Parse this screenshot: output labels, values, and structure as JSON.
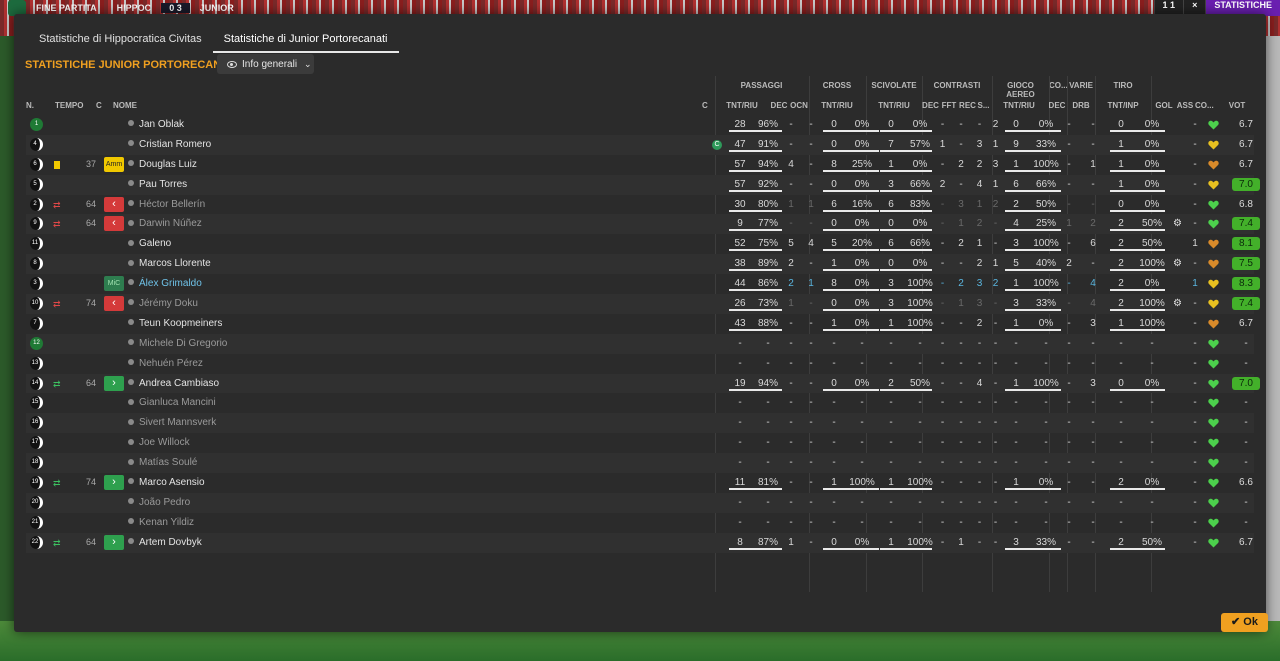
{
  "topbar": {
    "status": "FINE PARTITA",
    "home": "HIPPOC",
    "score": "0 3",
    "away": "JUNIOR",
    "right1": "1 1",
    "right2": "×",
    "right3": "STATISTICHE"
  },
  "tabs": [
    "Statistiche di Hippocratica Civitas",
    "Statistiche di Junior Portorecanati"
  ],
  "heading": "STATISTICHE JUNIOR PORTORECANATI",
  "dropdown": {
    "label": "Info generali"
  },
  "group_headers": {
    "passaggi": "PASSAGGI",
    "cross": "CROSS",
    "scivolate": "SCIVOLATE",
    "contrasti": "CONTRASTI",
    "gioco_aereo": "GIOCO AEREO",
    "co": "CO...",
    "varie": "VARIE",
    "tiro": "TIRO"
  },
  "column_headers": {
    "n": "N.",
    "tempo": "TEMPO",
    "c": "C",
    "nome": "NOME",
    "c2": "C",
    "p_tnt": "TNT/RIU",
    "p_dec": "DEC",
    "p_ocn": "OCN",
    "cr_tnt": "TNT/RIU",
    "sc_tnt": "TNT/RIU",
    "ct_dec": "DEC",
    "ct_fft": "FFT",
    "ct_rec": "REC",
    "ct_s": "S...",
    "ga_tnt": "TNT/RIU",
    "co_dec": "DEC",
    "va_drb": "DRB",
    "ti_tnt": "TNT/INP",
    "gol": "GOL",
    "ass": "ASS",
    "co2": "CO...",
    "vot": "VOT"
  },
  "ok_label": "Ok",
  "colors": {
    "accent": "#f0a020",
    "vote_green": "#43b02a",
    "heart_green": "#4cd04c",
    "heart_yellow": "#e8c020",
    "heart_orange": "#d88a2a"
  },
  "players": [
    {
      "n": "1",
      "gk": true,
      "name": "Jan Oblak",
      "p": [
        "28",
        "96%"
      ],
      "pd": "-",
      "po": "-",
      "cr": [
        "0",
        "0%"
      ],
      "sc": [
        "0",
        "0%"
      ],
      "ct": [
        "-",
        "-",
        "-",
        "2"
      ],
      "ga": [
        "0",
        "0%"
      ],
      "cod": "-",
      "drb": "-",
      "ti": [
        "0",
        "0%"
      ],
      "gol": "",
      "ass": "-",
      "heart": "green",
      "vot": "6.7"
    },
    {
      "n": "4",
      "name": "Cristian Romero",
      "cap": true,
      "p": [
        "47",
        "91%"
      ],
      "pd": "-",
      "po": "-",
      "cr": [
        "0",
        "0%"
      ],
      "sc": [
        "7",
        "57%"
      ],
      "ct": [
        "1",
        "-",
        "3",
        "1"
      ],
      "ga": [
        "9",
        "33%"
      ],
      "cod": "-",
      "drb": "-",
      "ti": [
        "1",
        "0%"
      ],
      "gol": "",
      "ass": "-",
      "heart": "yellow",
      "vot": "6.7"
    },
    {
      "n": "6",
      "name": "Douglas Luiz",
      "card": true,
      "tempo": "37",
      "badge": "Amm",
      "btype": "amm",
      "p": [
        "57",
        "94%"
      ],
      "pd": "4",
      "po": "-",
      "cr": [
        "8",
        "25%"
      ],
      "sc": [
        "1",
        "0%"
      ],
      "ct": [
        "-",
        "2",
        "2",
        "3"
      ],
      "ga": [
        "1",
        "100%"
      ],
      "cod": "-",
      "drb": "1",
      "ti": [
        "1",
        "0%"
      ],
      "gol": "",
      "ass": "-",
      "heart": "orange",
      "vot": "6.7"
    },
    {
      "n": "5",
      "name": "Pau Torres",
      "p": [
        "57",
        "92%"
      ],
      "pd": "-",
      "po": "-",
      "cr": [
        "0",
        "0%"
      ],
      "sc": [
        "3",
        "66%"
      ],
      "ct": [
        "2",
        "-",
        "4",
        "1"
      ],
      "ga": [
        "6",
        "66%"
      ],
      "cod": "-",
      "drb": "-",
      "ti": [
        "1",
        "0%"
      ],
      "gol": "",
      "ass": "-",
      "heart": "yellow",
      "vot": "7.0",
      "vg": true
    },
    {
      "n": "2",
      "name": "Héctor Bellerín",
      "dim": true,
      "sub": "out",
      "tempo": "64",
      "badge": "‹",
      "btype": "out",
      "p": [
        "30",
        "80%"
      ],
      "pd": "1",
      "po": "1",
      "cr": [
        "6",
        "16%"
      ],
      "sc": [
        "6",
        "83%"
      ],
      "ct": [
        "-",
        "3",
        "1",
        "2"
      ],
      "ga": [
        "2",
        "50%"
      ],
      "cod": "-",
      "drb": "-",
      "ti": [
        "0",
        "0%"
      ],
      "gol": "",
      "ass": "-",
      "heart": "green",
      "vot": "6.8"
    },
    {
      "n": "9",
      "name": "Darwin Núñez",
      "dim": true,
      "sub": "out",
      "tempo": "64",
      "badge": "‹",
      "btype": "out",
      "p": [
        "9",
        "77%"
      ],
      "pd": "-",
      "po": "-",
      "cr": [
        "0",
        "0%"
      ],
      "sc": [
        "0",
        "0%"
      ],
      "ct": [
        "-",
        "1",
        "2",
        "-"
      ],
      "ga": [
        "4",
        "25%"
      ],
      "cod": "1",
      "drb": "2",
      "ti": [
        "2",
        "50%"
      ],
      "gear": true,
      "gol": "",
      "ass": "-",
      "heart": "green",
      "vot": "7.4",
      "vg": true
    },
    {
      "n": "11",
      "name": "Galeno",
      "p": [
        "52",
        "75%"
      ],
      "pd": "5",
      "po": "4",
      "cr": [
        "5",
        "20%"
      ],
      "sc": [
        "6",
        "66%"
      ],
      "ct": [
        "-",
        "2",
        "1",
        "-"
      ],
      "ga": [
        "3",
        "100%"
      ],
      "cod": "-",
      "drb": "6",
      "ti": [
        "2",
        "50%"
      ],
      "gol": "",
      "ass": "1",
      "heart": "orange",
      "vot": "8.1",
      "vg": true
    },
    {
      "n": "8",
      "name": "Marcos Llorente",
      "p": [
        "38",
        "89%"
      ],
      "pd": "2",
      "po": "-",
      "cr": [
        "1",
        "0%"
      ],
      "sc": [
        "0",
        "0%"
      ],
      "ct": [
        "-",
        "-",
        "2",
        "1"
      ],
      "ga": [
        "5",
        "40%"
      ],
      "cod": "2",
      "drb": "-",
      "ti": [
        "2",
        "100%"
      ],
      "gear": true,
      "gol": "",
      "ass": "-",
      "heart": "orange",
      "vot": "7.5",
      "vg": true
    },
    {
      "n": "3",
      "name": "Álex Grimaldo",
      "hl": true,
      "badge": "MiC",
      "btype": "mic",
      "p": [
        "44",
        "86%"
      ],
      "pd": "2",
      "po": "1",
      "blue": true,
      "cr": [
        "8",
        "0%"
      ],
      "sc": [
        "3",
        "100%"
      ],
      "ct": [
        "-",
        "2",
        "3",
        "2"
      ],
      "ga": [
        "1",
        "100%"
      ],
      "cod": "-",
      "drb": "4",
      "ti": [
        "2",
        "0%"
      ],
      "gol": "",
      "ass": "1",
      "heart": "yellow",
      "vot": "8.3",
      "vg": true
    },
    {
      "n": "10",
      "name": "Jérémy Doku",
      "dim": true,
      "sub": "out",
      "tempo": "74",
      "badge": "‹",
      "btype": "out",
      "p": [
        "26",
        "73%"
      ],
      "pd": "1",
      "po": "-",
      "cr": [
        "0",
        "0%"
      ],
      "sc": [
        "3",
        "100%"
      ],
      "ct": [
        "-",
        "1",
        "3",
        "-"
      ],
      "ga": [
        "3",
        "33%"
      ],
      "cod": "-",
      "drb": "4",
      "ti": [
        "2",
        "100%"
      ],
      "gear": true,
      "gol": "",
      "ass": "-",
      "heart": "yellow",
      "vot": "7.4",
      "vg": true
    },
    {
      "n": "7",
      "name": "Teun Koopmeiners",
      "p": [
        "43",
        "88%"
      ],
      "pd": "-",
      "po": "-",
      "cr": [
        "1",
        "0%"
      ],
      "sc": [
        "1",
        "100%"
      ],
      "ct": [
        "-",
        "-",
        "2",
        "-"
      ],
      "ga": [
        "1",
        "0%"
      ],
      "cod": "-",
      "drb": "3",
      "ti": [
        "1",
        "100%"
      ],
      "gol": "",
      "ass": "-",
      "heart": "orange",
      "vot": "6.7"
    },
    {
      "n": "12",
      "gk": true,
      "name": "Michele Di Gregorio",
      "dim": true,
      "empty": true,
      "heart": "green"
    },
    {
      "n": "13",
      "name": "Nehuén Pérez",
      "dim": true,
      "empty": true,
      "heart": "green"
    },
    {
      "n": "14",
      "name": "Andrea Cambiaso",
      "sub": "in",
      "tempo": "64",
      "badge": "›",
      "btype": "in",
      "p": [
        "19",
        "94%"
      ],
      "pd": "-",
      "po": "-",
      "cr": [
        "0",
        "0%"
      ],
      "sc": [
        "2",
        "50%"
      ],
      "ct": [
        "-",
        "-",
        "4",
        "-"
      ],
      "ga": [
        "1",
        "100%"
      ],
      "cod": "-",
      "drb": "3",
      "ti": [
        "0",
        "0%"
      ],
      "gol": "",
      "ass": "-",
      "heart": "green",
      "vot": "7.0",
      "vg": true
    },
    {
      "n": "15",
      "name": "Gianluca Mancini",
      "dim": true,
      "empty": true,
      "heart": "green"
    },
    {
      "n": "16",
      "name": "Sivert Mannsverk",
      "dim": true,
      "empty": true,
      "heart": "green"
    },
    {
      "n": "17",
      "name": "Joe Willock",
      "dim": true,
      "empty": true,
      "heart": "green"
    },
    {
      "n": "18",
      "name": "Matías Soulé",
      "dim": true,
      "empty": true,
      "heart": "green"
    },
    {
      "n": "19",
      "name": "Marco Asensio",
      "sub": "in",
      "tempo": "74",
      "badge": "›",
      "btype": "in",
      "p": [
        "11",
        "81%"
      ],
      "pd": "-",
      "po": "-",
      "cr": [
        "1",
        "100%"
      ],
      "sc": [
        "1",
        "100%"
      ],
      "ct": [
        "-",
        "-",
        "-",
        "-"
      ],
      "ga": [
        "1",
        "0%"
      ],
      "cod": "-",
      "drb": "-",
      "ti": [
        "2",
        "0%"
      ],
      "gol": "",
      "ass": "-",
      "heart": "green",
      "vot": "6.6"
    },
    {
      "n": "20",
      "name": "João Pedro",
      "dim": true,
      "empty": true,
      "heart": "green"
    },
    {
      "n": "21",
      "name": "Kenan Yildiz",
      "dim": true,
      "empty": true,
      "heart": "green"
    },
    {
      "n": "22",
      "name": "Artem Dovbyk",
      "sub": "in",
      "tempo": "64",
      "badge": "›",
      "btype": "in",
      "p": [
        "8",
        "87%"
      ],
      "pd": "1",
      "po": "-",
      "cr": [
        "0",
        "0%"
      ],
      "sc": [
        "1",
        "100%"
      ],
      "ct": [
        "-",
        "1",
        "-",
        "-"
      ],
      "ga": [
        "3",
        "33%"
      ],
      "cod": "-",
      "drb": "-",
      "ti": [
        "2",
        "50%"
      ],
      "gol": "",
      "ass": "-",
      "heart": "green",
      "vot": "6.7"
    }
  ]
}
